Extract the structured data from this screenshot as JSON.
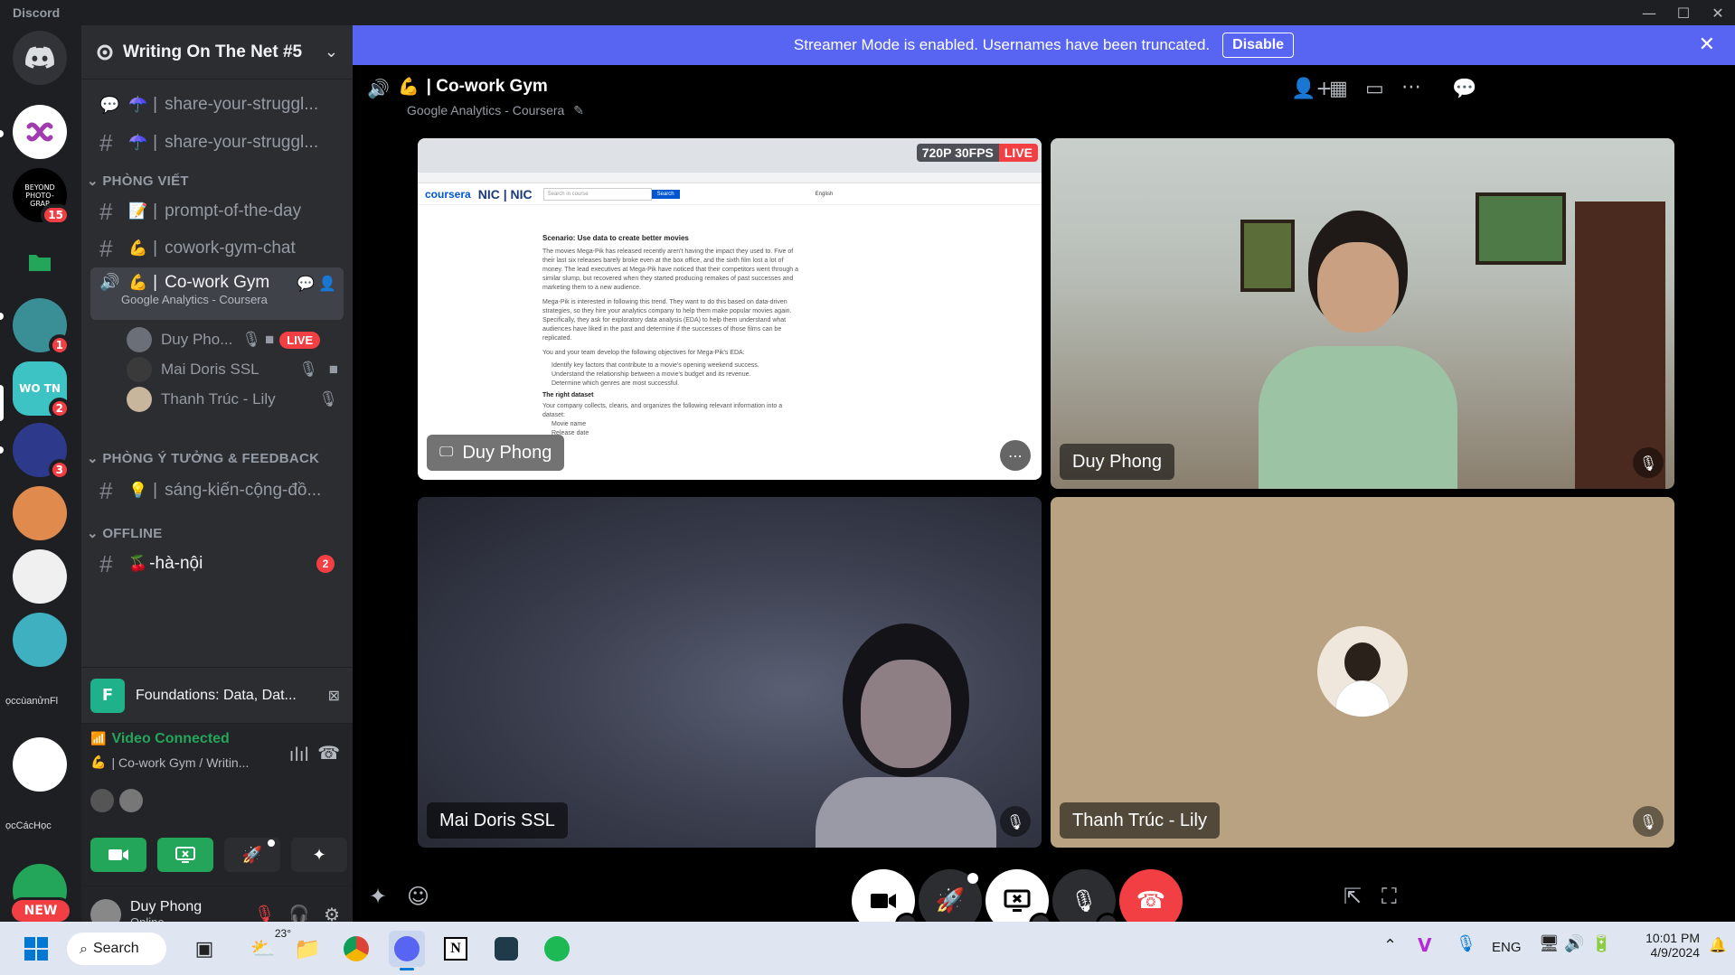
{
  "app": {
    "title": "Discord"
  },
  "servers": {
    "badges": {
      "beyond": "15",
      "s4": "1",
      "s5": "2",
      "s6": "3"
    },
    "labels": {
      "beyond": "BEYOND PHOTO-GRAP",
      "wo": "WO TN",
      "text1": "ọccùanửnFl",
      "text2": "ọcCácHọc",
      "new": "NEW"
    }
  },
  "guild": {
    "name": "Writing On The Net #5"
  },
  "channels": {
    "top": [
      {
        "emoji": "☂️",
        "name": "share-your-struggl..."
      },
      {
        "emoji": "☂️",
        "name": "share-your-struggl..."
      }
    ],
    "cat1": "PHÒNG VIẾT",
    "cat1_items": [
      {
        "emoji": "📝",
        "name": "prompt-of-the-day"
      },
      {
        "emoji": "💪",
        "name": "cowork-gym-chat"
      }
    ],
    "voice": {
      "emoji": "💪",
      "name": "Co-work Gym",
      "status": "Google Analytics - Coursera"
    },
    "voice_users": [
      {
        "name": "Duy Pho...",
        "live": "LIVE"
      },
      {
        "name": "Mai Doris SSL"
      },
      {
        "name": "Thanh Trúc - Lily"
      }
    ],
    "cat2": "PHÒNG Ý TƯỞNG & FEEDBACK",
    "cat2_items": [
      {
        "emoji": "💡",
        "name": "sáng-kiến-cộng-đồ..."
      }
    ],
    "cat3": "OFFLINE",
    "cat3_items": [
      {
        "emoji": "🍒",
        "name": "-hà-nội",
        "badge": "2"
      }
    ]
  },
  "activity": {
    "label": "Foundations: Data, Dat..."
  },
  "voice_panel": {
    "status": "Video Connected",
    "emoji": "💪",
    "location": "Co-work Gym / Writin..."
  },
  "user": {
    "name": "Duy Phong",
    "status": "Online"
  },
  "banner": {
    "text": "Streamer Mode is enabled. Usernames have been truncated.",
    "button": "Disable"
  },
  "call": {
    "emoji": "💪",
    "channel": "Co-work Gym",
    "status": "Google Analytics - Coursera"
  },
  "tiles": {
    "stream": {
      "name": "Duy Phong",
      "quality": "720P 30FPS",
      "live": "LIVE"
    },
    "cam1": {
      "name": "Duy Phong"
    },
    "cam2": {
      "name": "Mai Doris SSL"
    },
    "cam3": {
      "name": "Thanh Trúc - Lily"
    }
  },
  "doc": {
    "logo": "coursera",
    "search_placeholder": "Search in course",
    "search_btn": "Search",
    "lang": "English",
    "title": "Scenario: Use data to create better movies",
    "p1": "The movies Mega-Pik has released recently aren't having the impact they used to. Five of their last six releases barely broke even at the box office, and the sixth film lost a lot of money. The lead executives at Mega-Pik have noticed that their competitors went through a similar slump, but recovered when they started producing remakes of past successes and marketing them to a new audience.",
    "p2": "Mega-Pik is interested in following this trend. They want to do this based on data-driven strategies, so they hire your analytics company to help them make popular movies again. Specifically, they ask for exploratory data analysis (EDA) to help them understand what audiences have liked in the past and determine if the successes of those films can be replicated.",
    "p3": "You and your team develop the following objectives for Mega-Pik's EDA:",
    "bullets": [
      "Identify key factors that contribute to a movie's opening weekend success.",
      "Understand the relationship between a movie's budget and its revenue.",
      "Determine which genres are most successful."
    ],
    "h2": "The right dataset",
    "p4": "Your company collects, cleans, and organizes the following relevant information into a dataset:",
    "bullets2": [
      "Movie name",
      "Release date"
    ]
  },
  "taskbar": {
    "search": "Search",
    "weather": "23°",
    "lang": "ENG",
    "time": "10:01 PM",
    "date": "4/9/2024"
  }
}
